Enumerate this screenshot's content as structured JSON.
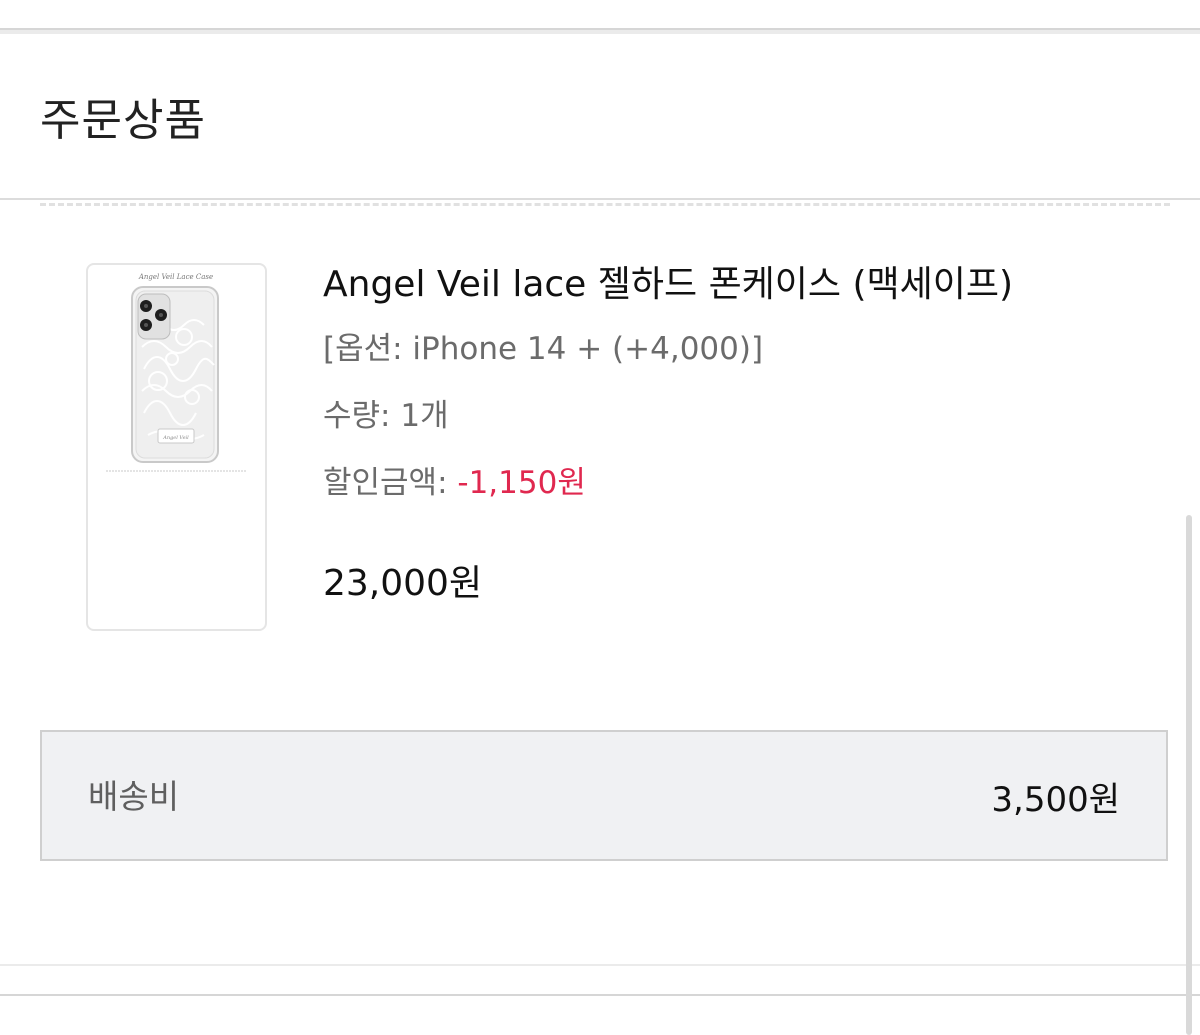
{
  "section": {
    "title": "주문상품"
  },
  "product": {
    "image_alt": "Angel Veil Lace Case",
    "name": "Angel Veil lace 젤하드 폰케이스 (맥세이프)",
    "option": "[옵션: iPhone 14 + (+4,000)]",
    "quantity_label": "수량: ",
    "quantity_value": "1개",
    "discount_label": "할인금액: ",
    "discount_value": "-1,150원",
    "price": "23,000원"
  },
  "shipping": {
    "label": "배송비",
    "value": "3,500원"
  },
  "colors": {
    "discount": "#e0284f",
    "text_primary": "#111111",
    "text_secondary": "#6b6b6b",
    "shipping_bg": "#f0f1f3"
  }
}
